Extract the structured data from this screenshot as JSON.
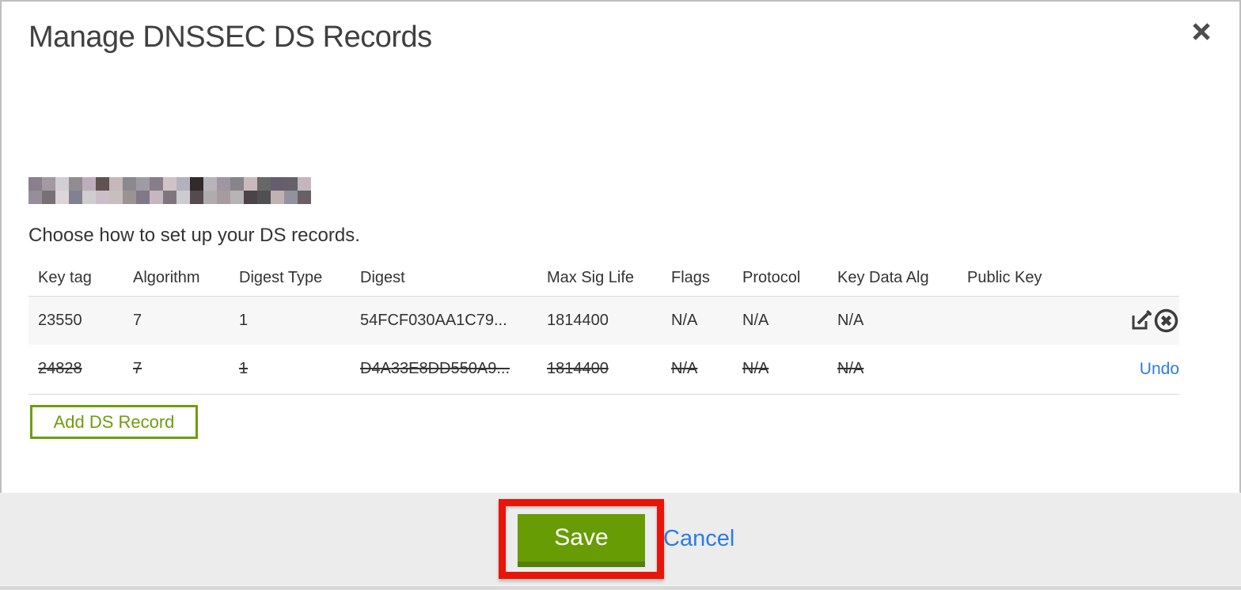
{
  "header": {
    "title": "Manage DNSSEC DS Records",
    "close_icon": "x-close"
  },
  "main": {
    "redacted_domain_note": "redacted-pixelated-domain",
    "instructions": "Choose how to set up your DS records."
  },
  "table": {
    "columns": [
      "Key tag",
      "Algorithm",
      "Digest Type",
      "Digest",
      "Max Sig Life",
      "Flags",
      "Protocol",
      "Key Data Alg",
      "Public Key"
    ],
    "rows": [
      {
        "key_tag": "23550",
        "algorithm": "7",
        "digest_type": "1",
        "digest": "54FCF030AA1C79...",
        "max_sig_life": "1814400",
        "flags": "N/A",
        "protocol": "N/A",
        "key_data_alg": "N/A",
        "public_key": "",
        "state": "active",
        "action_icons": [
          "edit-icon",
          "delete-circle-x-icon"
        ]
      },
      {
        "key_tag": "24828",
        "algorithm": "7",
        "digest_type": "1",
        "digest": "D4A33E8DD550A9...",
        "max_sig_life": "1814400",
        "flags": "N/A",
        "protocol": "N/A",
        "key_data_alg": "N/A",
        "public_key": "",
        "state": "marked-for-deletion",
        "action_label": "Undo"
      }
    ]
  },
  "buttons": {
    "add_ds_record": "Add DS Record",
    "save": "Save",
    "cancel": "Cancel"
  },
  "colors": {
    "accent_green": "#689c04",
    "accent_green_dark": "#557f0c",
    "outline_green": "#6d9d0e",
    "link_blue": "#2d7ce2",
    "annotation_red": "#ea1508",
    "footer_gray": "#ececec",
    "row_gray": "#f7f7f7"
  }
}
